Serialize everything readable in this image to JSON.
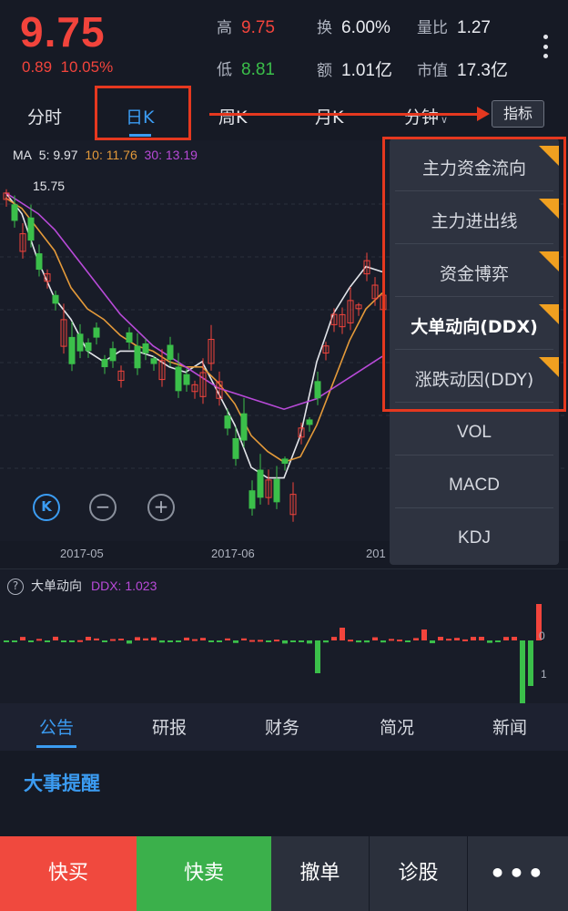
{
  "quote": {
    "price": "9.75",
    "change": "0.89",
    "change_pct": "10.05%",
    "stats": [
      {
        "label": "高",
        "value": "9.75",
        "color": "red"
      },
      {
        "label": "换",
        "value": "6.00%",
        "color": "white"
      },
      {
        "label": "量比",
        "value": "1.27",
        "color": "white"
      },
      {
        "label": "低",
        "value": "8.81",
        "color": "green"
      },
      {
        "label": "额",
        "value": "1.01亿",
        "color": "white"
      },
      {
        "label": "市值",
        "value": "17.3亿",
        "color": "white"
      }
    ]
  },
  "tabs": {
    "items": [
      "分时",
      "日K",
      "周K",
      "月K",
      "分钟"
    ],
    "active": "日K",
    "indicator_button": "指标"
  },
  "chart": {
    "ma_label": "MA",
    "ma5": "5: 9.97",
    "ma10": "10: 11.76",
    "ma30": "30: 13.19",
    "high_marker": "15.75",
    "dates": [
      "2017-05",
      "2017-06",
      "201"
    ],
    "zoom": {
      "k": "K",
      "minus": "−",
      "plus": "+"
    },
    "colors": {
      "up": "#f2443c",
      "down": "#3bbf4a",
      "ma5": "#e3e5ea",
      "ma10": "#e49a3a",
      "ma30": "#b84ad8",
      "accent": "#3b9cf2"
    }
  },
  "sub_chart": {
    "help": "?",
    "title": "大单动向",
    "ddx_value": "DDX: 1.023",
    "tick_zero": "0",
    "tick_one": "1"
  },
  "indicator_menu": {
    "items": [
      "主力资金流向",
      "主力进出线",
      "资金博弈",
      "大单动向(DDX)",
      "涨跌动因(DDY)",
      "VOL",
      "MACD",
      "KDJ"
    ]
  },
  "news": {
    "tabs": [
      "公告",
      "研报",
      "财务",
      "简况",
      "新闻"
    ],
    "active": "公告",
    "section_title": "大事提醒"
  },
  "bottom_bar": {
    "buy": "快买",
    "sell": "快卖",
    "cancel": "撤单",
    "diagnose": "诊股",
    "more": "•••"
  },
  "chart_data": {
    "type": "candlestick",
    "x": [
      "2017-05",
      "2017-06",
      "201"
    ],
    "series": [
      {
        "name": "5",
        "values": [
          15.6,
          15.2,
          14.3,
          13.6,
          13.2,
          12.6,
          12.4,
          12.6,
          12.6,
          12.5,
          12.3,
          12.2,
          12.4,
          11.8,
          11.2,
          10.4,
          10.2,
          10.2,
          11.0,
          12.4,
          13.3,
          13.8,
          14.2,
          14.1
        ]
      },
      {
        "name": "10",
        "values": [
          15.5,
          15.3,
          14.9,
          14.5,
          13.8,
          13.4,
          13.2,
          12.9,
          12.7,
          12.6,
          12.4,
          12.3,
          12.3,
          12.0,
          11.6,
          11.0,
          10.7,
          10.5,
          10.6,
          11.2,
          12.0,
          12.8,
          13.4,
          13.7
        ]
      },
      {
        "name": "30",
        "values": [
          15.6,
          15.4,
          15.2,
          14.9,
          14.5,
          14.1,
          13.7,
          13.3,
          13.0,
          12.7,
          12.5,
          12.3,
          12.1,
          11.9,
          11.8,
          11.7,
          11.6,
          11.5,
          11.6,
          11.7,
          11.9,
          12.1,
          12.3,
          12.5
        ]
      }
    ]
  }
}
